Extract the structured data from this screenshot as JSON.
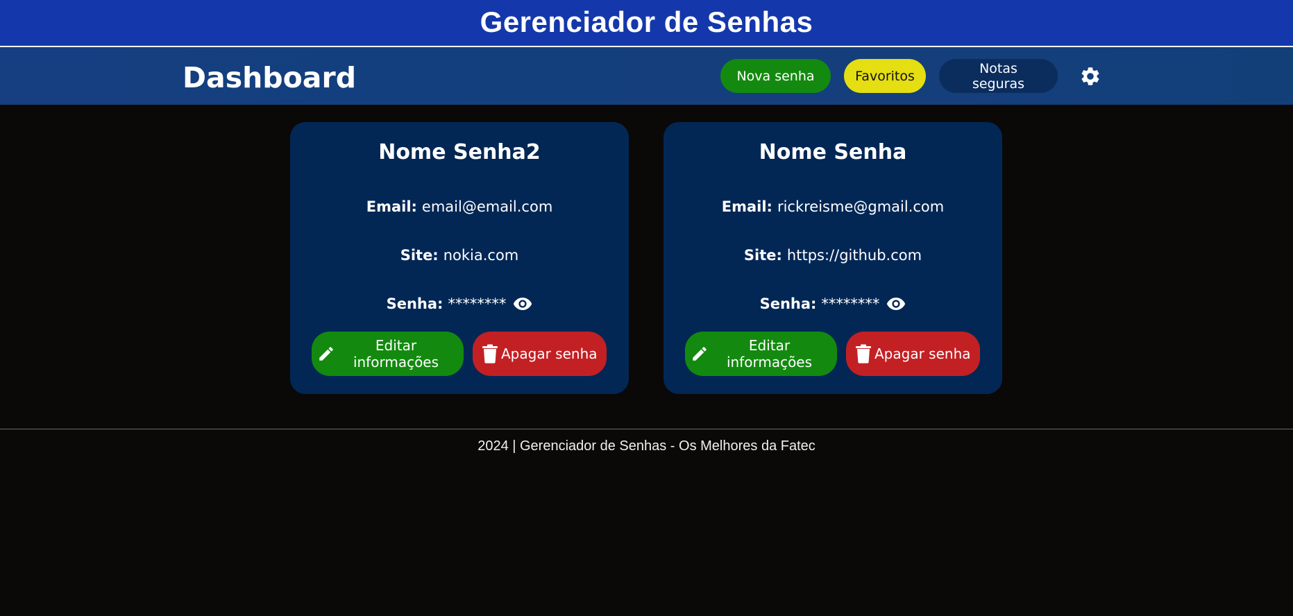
{
  "app": {
    "title": "Gerenciador de Senhas"
  },
  "dashboard": {
    "title": "Dashboard",
    "nav": {
      "new_password": "Nova senha",
      "favorites": "Favoritos",
      "secure_notes": "Notas seguras",
      "settings_icon": "gear-icon"
    }
  },
  "labels": {
    "email": "Email:",
    "site": "Site:",
    "password": "Senha:"
  },
  "cards": [
    {
      "name": "Nome Senha2",
      "email": "email@email.com",
      "site": "nokia.com",
      "password_masked": "********",
      "edit_label": "Editar informações",
      "delete_label": "Apagar senha"
    },
    {
      "name": "Nome Senha",
      "email": "rickreisme@gmail.com",
      "site": "https://github.com",
      "password_masked": "********",
      "edit_label": "Editar informações",
      "delete_label": "Apagar senha"
    }
  ],
  "footer": {
    "text": "2024 | Gerenciador de Senhas - Os Melhores da Fatec"
  },
  "colors": {
    "header_bg": "#1438ab",
    "bar_bg": "#153f80",
    "page_bg": "#0a0908",
    "card_bg": "#022755",
    "green": "#138a0f",
    "yellow": "#e4de12",
    "red": "#c32024",
    "notes_bg": "#0b2d5e"
  }
}
